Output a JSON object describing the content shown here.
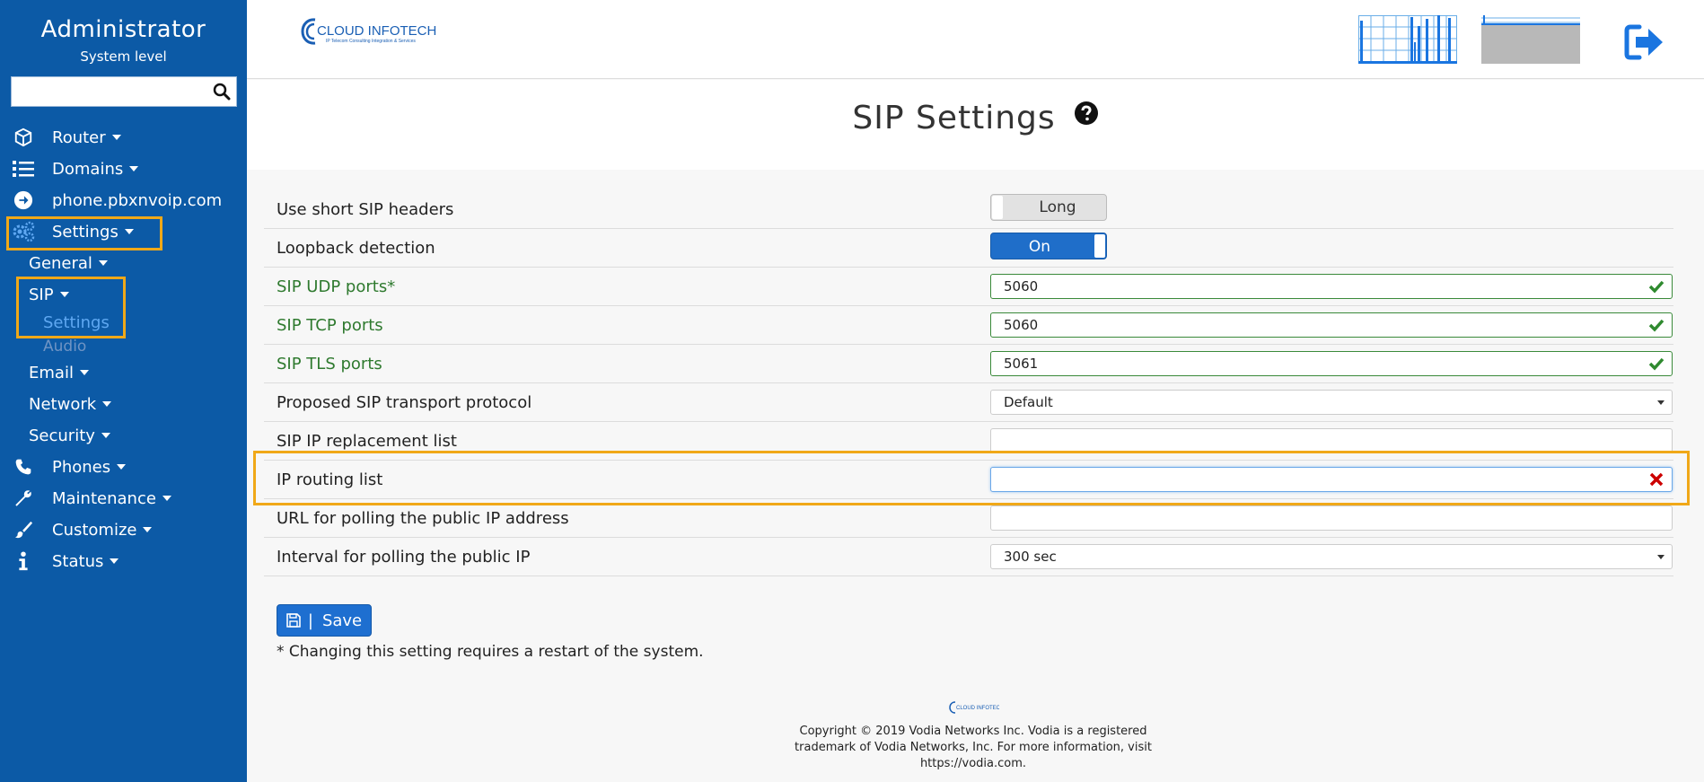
{
  "sidebar": {
    "title": "Administrator",
    "subtitle": "System level",
    "search_placeholder": "",
    "items": [
      {
        "label": "Router",
        "icon": "cube-icon"
      },
      {
        "label": "Domains",
        "icon": "list-icon"
      },
      {
        "label": "phone.pbxnvoip.com",
        "icon": "arrow-circle-right-icon"
      },
      {
        "label": "Settings",
        "icon": "cogs-icon"
      },
      {
        "label": "Phones",
        "icon": "phone-icon"
      },
      {
        "label": "Maintenance",
        "icon": "wrench-icon"
      },
      {
        "label": "Customize",
        "icon": "brush-icon"
      },
      {
        "label": "Status",
        "icon": "info-icon"
      }
    ],
    "settings_sub": {
      "general": "General",
      "sip": "SIP",
      "sip_settings": "Settings",
      "sip_audio": "Audio",
      "email": "Email",
      "network": "Network",
      "security": "Security"
    }
  },
  "header": {
    "logo_text": "CLOUD INFOTECH",
    "logo_tagline": "IP Telecom Consulting Integration & Services"
  },
  "page": {
    "title": "SIP Settings"
  },
  "settings": {
    "short_headers": {
      "label": "Use short SIP headers",
      "value": "Long"
    },
    "loopback": {
      "label": "Loopback detection",
      "value": "On"
    },
    "udp_ports": {
      "label": "SIP UDP ports*",
      "value": "5060"
    },
    "tcp_ports": {
      "label": "SIP TCP ports",
      "value": "5060"
    },
    "tls_ports": {
      "label": "SIP TLS ports",
      "value": "5061"
    },
    "transport": {
      "label": "Proposed SIP transport protocol",
      "value": "Default"
    },
    "ip_replacement": {
      "label": "SIP IP replacement list",
      "value": ""
    },
    "ip_routing": {
      "label": "IP routing list",
      "value": ""
    },
    "poll_url": {
      "label": "URL for polling the public IP address",
      "value": ""
    },
    "poll_interval": {
      "label": "Interval for polling the public IP",
      "value": "300 sec"
    }
  },
  "actions": {
    "save_label": "Save",
    "separator": "|"
  },
  "note": "* Changing this setting requires a restart of the system.",
  "footer": {
    "line1": "Copyright © 2019 Vodia Networks Inc. Vodia is a registered",
    "line2": "trademark of Vodia Networks, Inc. For more information, visit",
    "line3": "https://vodia.com."
  },
  "colors": {
    "sidebar_bg": "#0c5aa6",
    "highlight": "#f0a818",
    "valid": "#2f7a2f",
    "invalid": "#cc0000",
    "button": "#1e6fd0"
  }
}
